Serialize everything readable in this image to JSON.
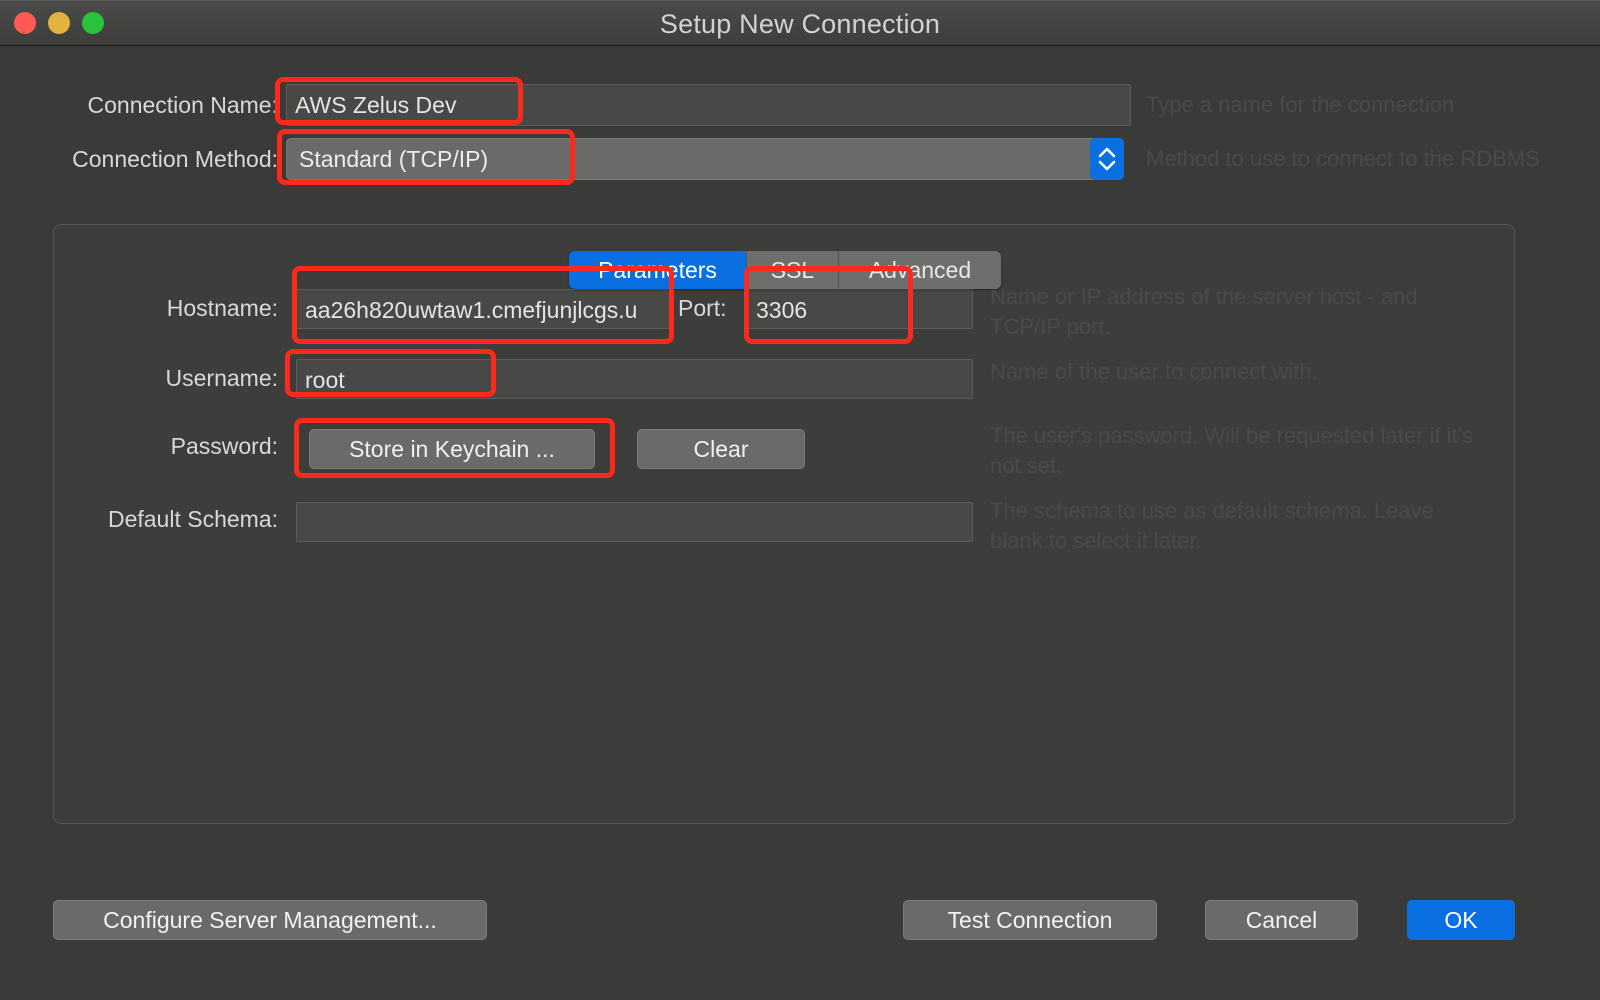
{
  "window": {
    "title": "Setup New Connection",
    "traffic_lights": [
      {
        "name": "close",
        "color": "#ff5b52"
      },
      {
        "name": "minimize",
        "color": "#e3b341"
      },
      {
        "name": "zoom",
        "color": "#29c43c"
      }
    ]
  },
  "form": {
    "connection_name": {
      "label": "Connection Name:",
      "value": "AWS Zelus Dev",
      "hint": "Type a name for the connection"
    },
    "connection_method": {
      "label": "Connection Method:",
      "value": "Standard (TCP/IP)",
      "hint": "Method to use to connect to the RDBMS"
    }
  },
  "tabs": [
    {
      "label": "Parameters",
      "active": true
    },
    {
      "label": "SSL",
      "active": false
    },
    {
      "label": "Advanced",
      "active": false
    }
  ],
  "parameters": {
    "hostname": {
      "label": "Hostname:",
      "value": "aa26h820uwtaw1.cmefjunjlcgs.u",
      "hint": "Name or IP address of the server host - and TCP/IP port."
    },
    "port": {
      "label": "Port:",
      "value": "3306"
    },
    "username": {
      "label": "Username:",
      "value": "root",
      "hint": "Name of the user to connect with."
    },
    "password": {
      "label": "Password:",
      "store_button": "Store in Keychain ...",
      "clear_button": "Clear",
      "hint": "The user's password. Will be requested later if it's not set."
    },
    "default_schema": {
      "label": "Default Schema:",
      "value": "",
      "hint": "The schema to use as default schema. Leave blank to select it later."
    }
  },
  "footer": {
    "configure_server_management": "Configure Server Management...",
    "test_connection": "Test Connection",
    "cancel": "Cancel",
    "ok": "OK"
  },
  "colors": {
    "accent": "#0a6fe0",
    "annotation": "#fc2a1c",
    "window_bg": "#3a3a38",
    "field_bg": "#484846"
  }
}
